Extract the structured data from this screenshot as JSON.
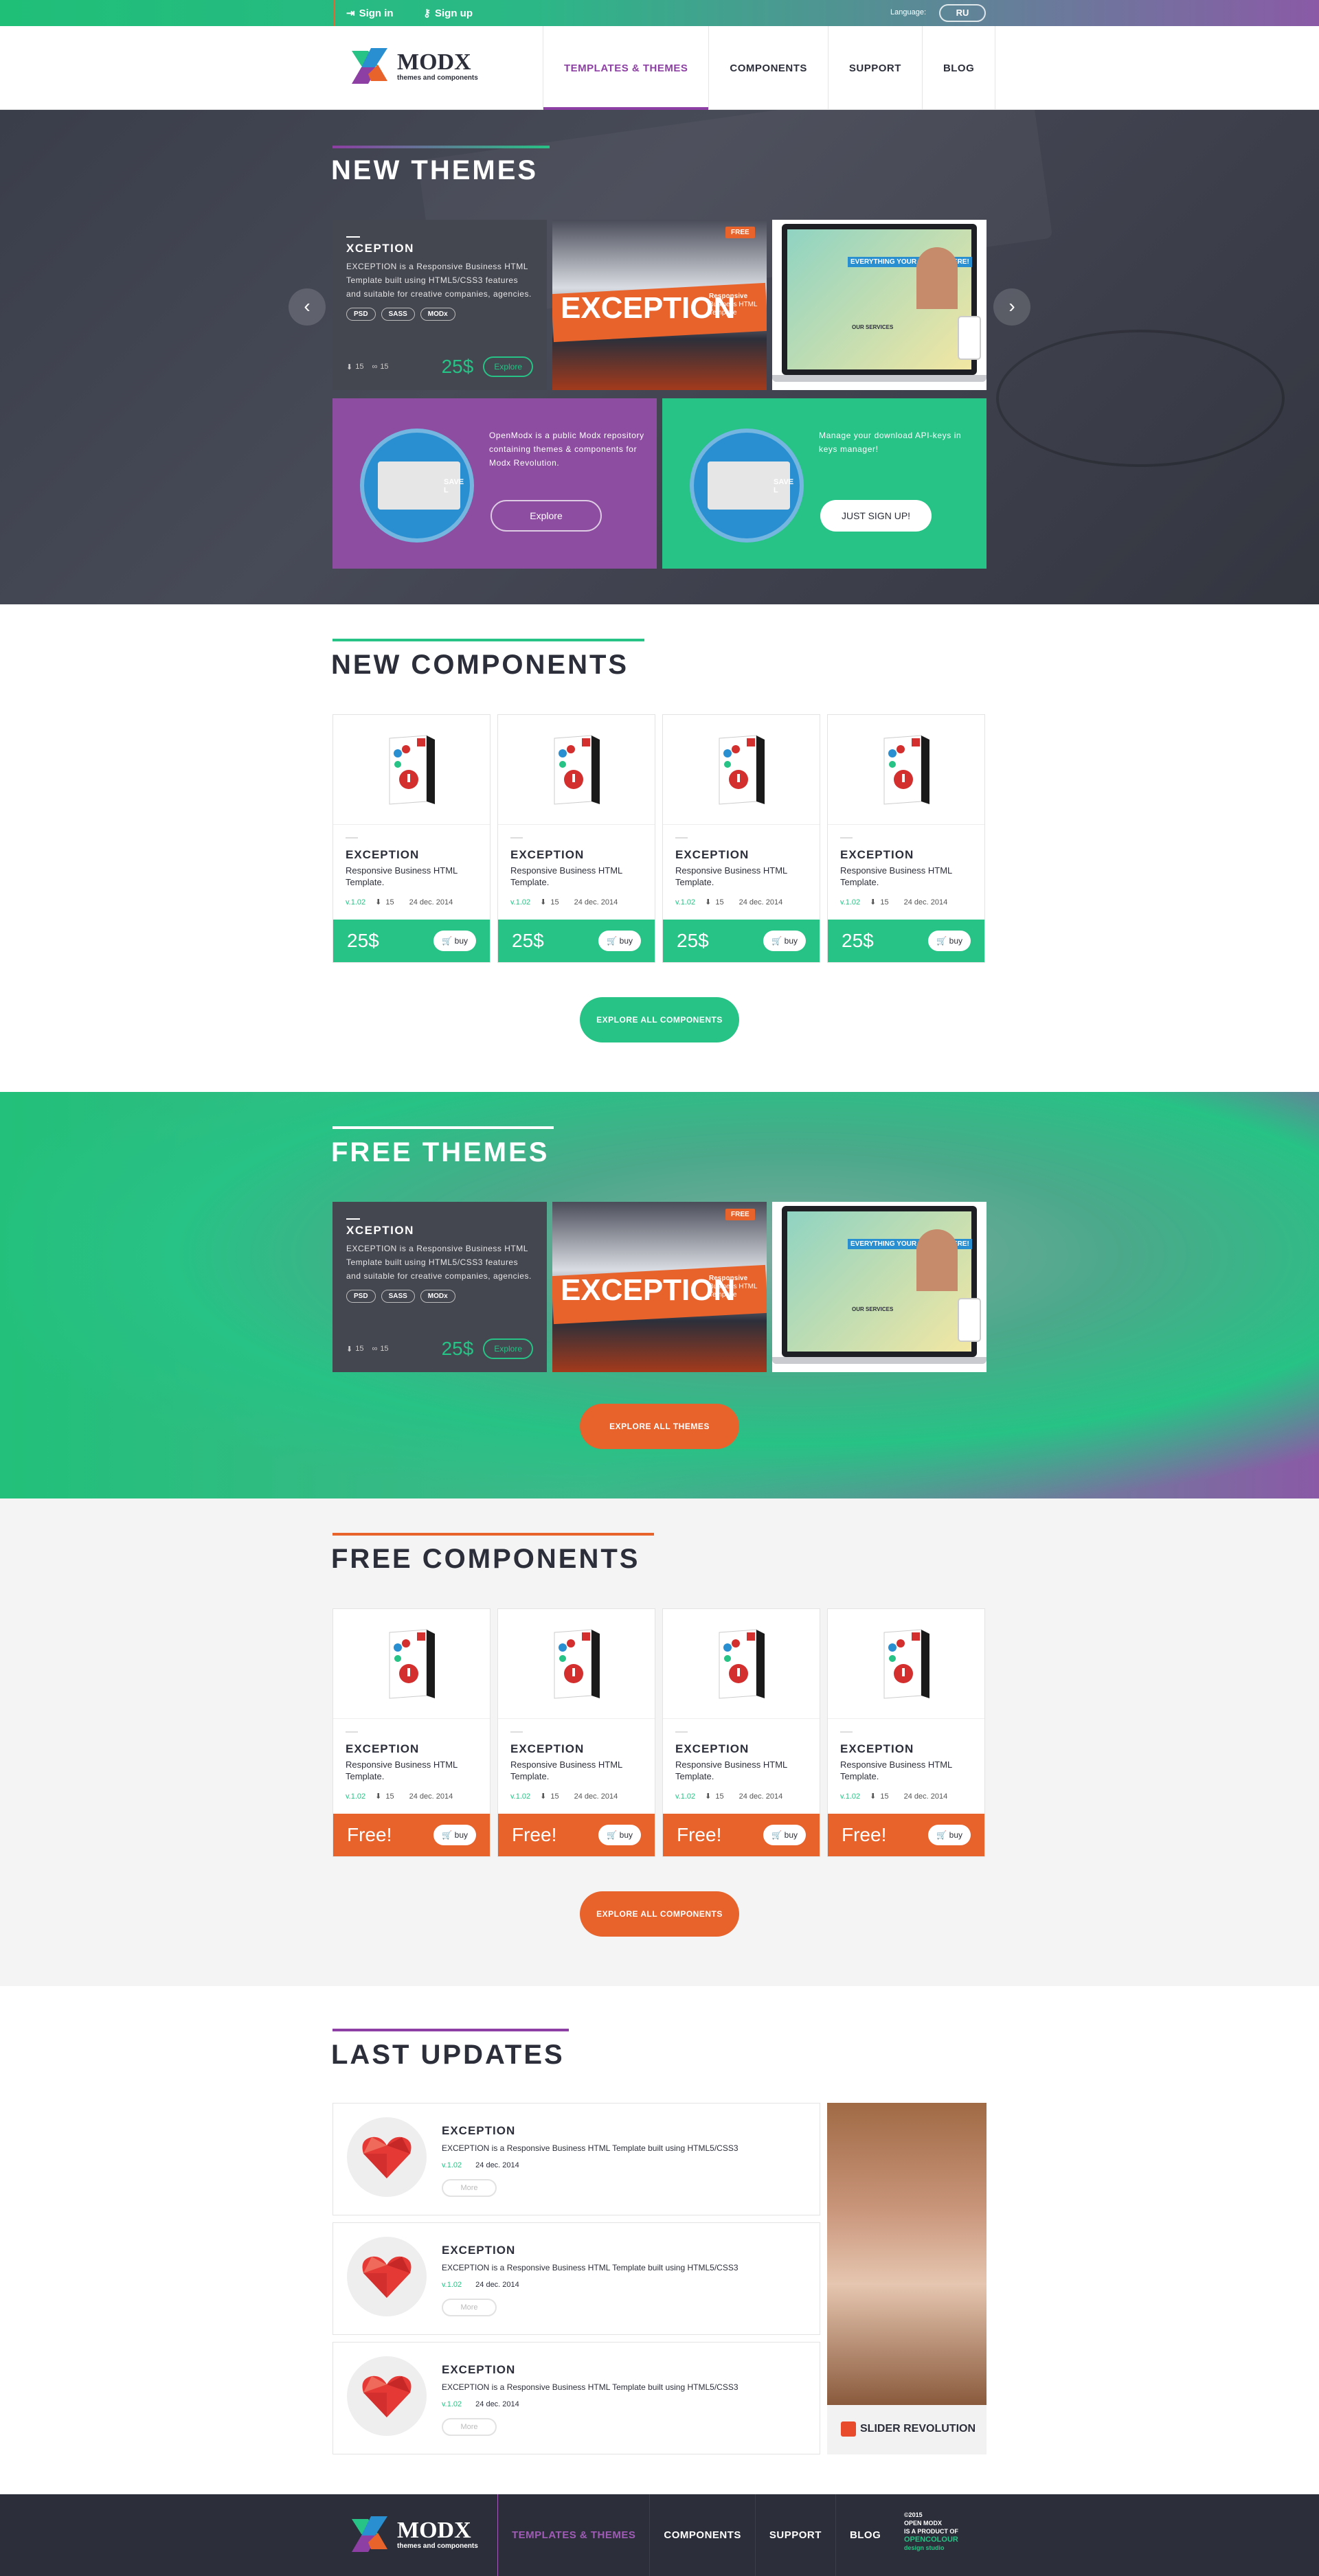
{
  "topbar": {
    "sign_in": "Sign in",
    "sign_up": "Sign up",
    "language_label": "Language:",
    "language": "RU"
  },
  "logo": {
    "name": "MODX",
    "tagline": "themes and components"
  },
  "nav": [
    {
      "label": "TEMPLATES & THEMES",
      "active": true
    },
    {
      "label": "COMPONENTS"
    },
    {
      "label": "SUPPORT"
    },
    {
      "label": "BLOG"
    }
  ],
  "new_themes": {
    "title": "NEW THEMES",
    "card": {
      "name": "XCEPTION",
      "description": "EXCEPTION is a Responsive Business HTML Template built using HTML5/CSS3 features and suitable for creative companies, agencies.",
      "tags": [
        "PSD",
        "SASS",
        "MODx"
      ],
      "stat1": "15",
      "stat2": "15",
      "price": "25$",
      "explore": "Explore"
    },
    "shot_badge": "FREE",
    "shot_title": "EXCEPTION",
    "shot_sub1": "Responsive",
    "shot_sub2": "Business HTML",
    "shot_sub3": "Template",
    "shot3_headline": "EVERYTHING YOUR NEED IS HERE!",
    "shot3_services": "OUR SERVICES",
    "prev_arrow": "‹",
    "next_arrow": "›",
    "promo_purple": {
      "text": "OpenModx is a public Modx repository containing themes & components for Modx Revolution.",
      "button": "Explore"
    },
    "promo_green": {
      "text": "Manage your download API-keys in keys manager!",
      "button": "JUST SIGN UP!"
    },
    "save_label": "SAVE L"
  },
  "new_components": {
    "title": "NEW COMPONENTS",
    "items": [
      {
        "name": "EXCEPTION",
        "desc": "Responsive Business HTML Template.",
        "version": "v.1.02",
        "count": "15",
        "date": "24 dec. 2014",
        "price": "25$",
        "buy": "buy"
      },
      {
        "name": "EXCEPTION",
        "desc": "Responsive Business HTML Template.",
        "version": "v.1.02",
        "count": "15",
        "date": "24 dec. 2014",
        "price": "25$",
        "buy": "buy"
      },
      {
        "name": "EXCEPTION",
        "desc": "Responsive Business HTML Template.",
        "version": "v.1.02",
        "count": "15",
        "date": "24 dec. 2014",
        "price": "25$",
        "buy": "buy"
      },
      {
        "name": "EXCEPTION",
        "desc": "Responsive Business HTML Template.",
        "version": "v.1.02",
        "count": "15",
        "date": "24 dec. 2014",
        "price": "25$",
        "buy": "buy"
      }
    ],
    "button": "EXPLORE ALL COMPONENTS"
  },
  "free_themes": {
    "title": "FREE THEMES",
    "card": {
      "name": "XCEPTION",
      "description": "EXCEPTION is a Responsive Business HTML Template built using HTML5/CSS3 features and suitable for creative companies, agencies.",
      "tags": [
        "PSD",
        "SASS",
        "MODx"
      ],
      "stat1": "15",
      "stat2": "15",
      "price": "25$",
      "explore": "Explore"
    },
    "button": "EXPLORE ALL THEMES"
  },
  "free_components": {
    "title": "FREE COMPONENTS",
    "items": [
      {
        "name": "EXCEPTION",
        "desc": "Responsive Business HTML Template.",
        "version": "v.1.02",
        "count": "15",
        "date": "24 dec. 2014",
        "price": "Free!",
        "buy": "buy"
      },
      {
        "name": "EXCEPTION",
        "desc": "Responsive Business HTML Template.",
        "version": "v.1.02",
        "count": "15",
        "date": "24 dec. 2014",
        "price": "Free!",
        "buy": "buy"
      },
      {
        "name": "EXCEPTION",
        "desc": "Responsive Business HTML Template.",
        "version": "v.1.02",
        "count": "15",
        "date": "24 dec. 2014",
        "price": "Free!",
        "buy": "buy"
      },
      {
        "name": "EXCEPTION",
        "desc": "Responsive Business HTML Template.",
        "version": "v.1.02",
        "count": "15",
        "date": "24 dec. 2014",
        "price": "Free!",
        "buy": "buy"
      }
    ],
    "button": "EXPLORE ALL COMPONENTS"
  },
  "last_updates": {
    "title": "LAST UPDATES",
    "items": [
      {
        "name": "EXCEPTION",
        "desc": "EXCEPTION is a Responsive Business HTML Template built using HTML5/CSS3",
        "version": "v.1.02",
        "date": "24 dec. 2014",
        "more": "More"
      },
      {
        "name": "EXCEPTION",
        "desc": "EXCEPTION is a Responsive Business HTML Template built using HTML5/CSS3",
        "version": "v.1.02",
        "date": "24 dec. 2014",
        "more": "More"
      },
      {
        "name": "EXCEPTION",
        "desc": "EXCEPTION is a Responsive Business HTML Template built using HTML5/CSS3",
        "version": "v.1.02",
        "date": "24 dec. 2014",
        "more": "More"
      }
    ],
    "ad_label": "SLIDER REVOLUTION"
  },
  "footer": {
    "nav": [
      {
        "label": "TEMPLATES & THEMES",
        "active": true
      },
      {
        "label": "COMPONENTS"
      },
      {
        "label": "SUPPORT"
      },
      {
        "label": "BLOG"
      }
    ],
    "copyright": "©2015",
    "line1": "OPEN MODX",
    "line2": "IS A PRODUCT OF",
    "brand": "OPENCOLOUR",
    "brand_sub": "design studio"
  },
  "colors": {
    "green": "#27c285",
    "purple": "#8d3fa3",
    "orange": "#e8622c",
    "dark": "#2c2f3a"
  }
}
